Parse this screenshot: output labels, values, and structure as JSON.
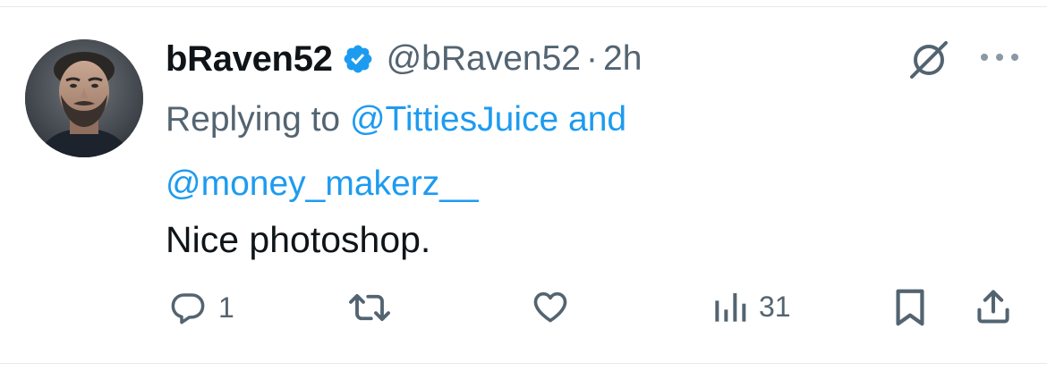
{
  "tweet": {
    "display_name": "bRaven52",
    "handle": "@bRaven52",
    "separator": "·",
    "time": "2h",
    "replying_prefix": "Replying to",
    "reply_mention_1": "@TittiesJuice",
    "reply_conjunction": "and",
    "reply_mention_2": "@money_makerz__",
    "text": "Nice photoshop.",
    "verified_icon": "verified-badge-icon",
    "accent_color": "#1d9bf0",
    "secondary_text_color": "#536471"
  },
  "actions": {
    "reply_count": "1",
    "retweet_count": "",
    "like_count": "",
    "views_count": "31",
    "icons": [
      "reply-icon",
      "retweet-icon",
      "like-icon",
      "views-icon",
      "bookmark-icon",
      "share-icon"
    ]
  },
  "header_icons": [
    "grok-icon",
    "more-icon"
  ]
}
